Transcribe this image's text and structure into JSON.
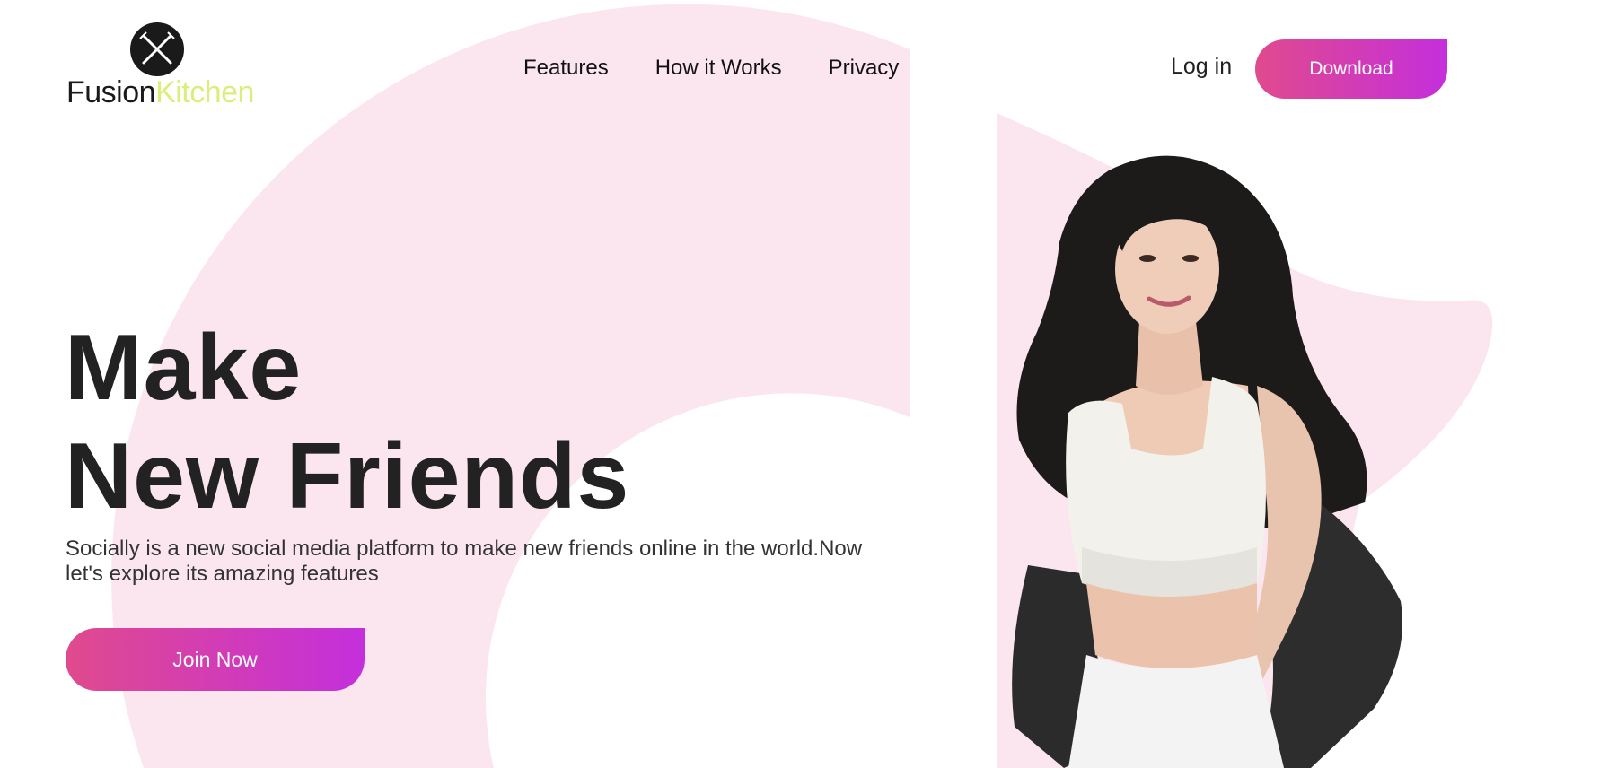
{
  "brand": {
    "name_part1": "Fusion",
    "name_part2": "Kitchen",
    "icon": "fork-knife-icon"
  },
  "nav": {
    "items": [
      {
        "label": "Features"
      },
      {
        "label": "How it Works"
      },
      {
        "label": "Privacy"
      }
    ]
  },
  "header": {
    "login_label": "Log in",
    "download_label": "Download"
  },
  "hero": {
    "line1": "Make",
    "line2": "New Friends",
    "description": "Socially is a new social media platform to make new friends online in the world.Now let's explore its amazing features",
    "cta_label": "Join Now"
  },
  "colors": {
    "accent_start": "#e04a8d",
    "accent_end": "#c42fdc",
    "background_shape": "#fbe6f0",
    "logo_accent": "#d9ef7a"
  }
}
